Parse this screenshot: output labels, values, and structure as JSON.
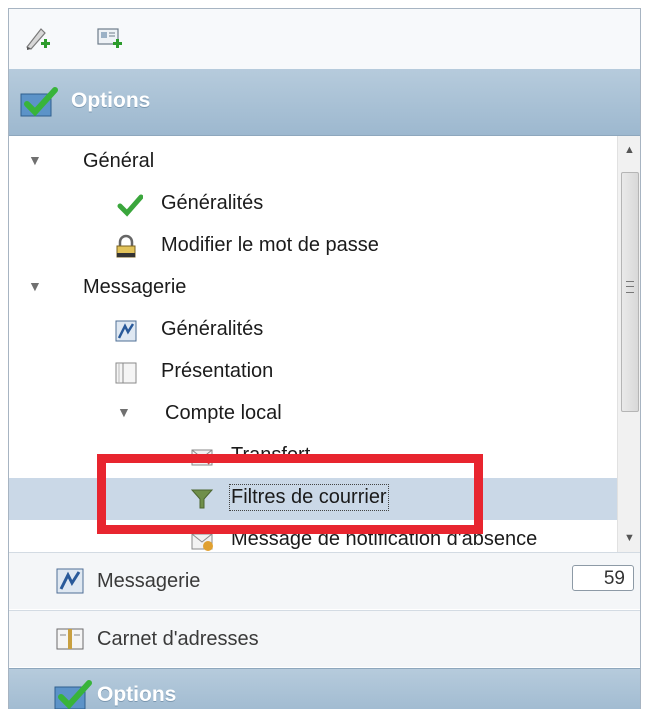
{
  "toolbar": {
    "buttons": [
      {
        "icon": "new-contact-icon"
      },
      {
        "icon": "new-card-icon"
      }
    ]
  },
  "header": {
    "icon": "options-check-icon",
    "title": "Options"
  },
  "tree": {
    "items": [
      {
        "label": "Général",
        "icon": "",
        "expanded": true,
        "level": 0
      },
      {
        "label": "Généralités",
        "icon": "green-check-icon",
        "level": 1
      },
      {
        "label": "Modifier le mot de passe",
        "icon": "lock-icon",
        "level": 1
      },
      {
        "label": "Messagerie",
        "icon": "",
        "expanded": true,
        "level": 0
      },
      {
        "label": "Généralités",
        "icon": "messaging-settings-icon",
        "level": 1
      },
      {
        "label": "Présentation",
        "icon": "layout-icon",
        "level": 1
      },
      {
        "label": "Compte local",
        "icon": "",
        "expanded": true,
        "level": 1
      },
      {
        "label": "Transfert",
        "icon": "forward-mail-icon",
        "level": 2
      },
      {
        "label": "Filtres de courrier",
        "icon": "funnel-filter-icon",
        "level": 2,
        "selected": true
      },
      {
        "label": "Message de notification d'absence",
        "icon": "out-of-office-icon",
        "level": 2
      }
    ]
  },
  "nav": {
    "messagerie": {
      "label": "Messagerie",
      "icon": "mail-app-icon",
      "count": "59"
    },
    "carnet": {
      "label": "Carnet d'adresses",
      "icon": "address-book-icon"
    },
    "options": {
      "label": "Options",
      "icon": "options-check-icon"
    }
  },
  "colors": {
    "header_bg": "#9db8cf",
    "selected_row": "#cad8e7",
    "highlight_border": "#e8252f"
  }
}
